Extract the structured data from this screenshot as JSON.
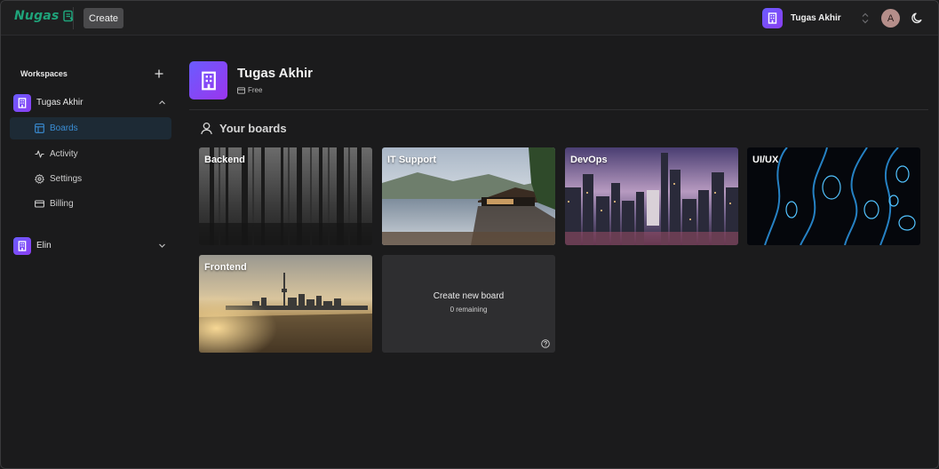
{
  "topbar": {
    "logo_text": "Nugas",
    "create_label": "Create",
    "workspace_name": "Tugas Akhir",
    "user_initial": "A"
  },
  "sidebar": {
    "header": "Workspaces",
    "workspaces": [
      {
        "name": "Tugas Akhir",
        "expanded": true,
        "items": [
          {
            "label": "Boards",
            "icon": "layout-icon",
            "active": true
          },
          {
            "label": "Activity",
            "icon": "activity-icon",
            "active": false
          },
          {
            "label": "Settings",
            "icon": "gear-icon",
            "active": false
          },
          {
            "label": "Billing",
            "icon": "credit-card-icon",
            "active": false
          }
        ]
      },
      {
        "name": "Elin",
        "expanded": false
      }
    ]
  },
  "main": {
    "org_name": "Tugas Akhir",
    "org_plan": "Free",
    "boards_title": "Your boards",
    "boards": [
      {
        "title": "Backend"
      },
      {
        "title": "IT Support"
      },
      {
        "title": "DevOps"
      },
      {
        "title": "UI/UX"
      },
      {
        "title": "Frontend"
      }
    ],
    "new_board": {
      "title": "Create new board",
      "remaining": "0 remaining"
    }
  },
  "colors": {
    "accent": "#3a8ed6",
    "brand": "#1fa37a",
    "workspace_avatar": "#7a4df5"
  }
}
